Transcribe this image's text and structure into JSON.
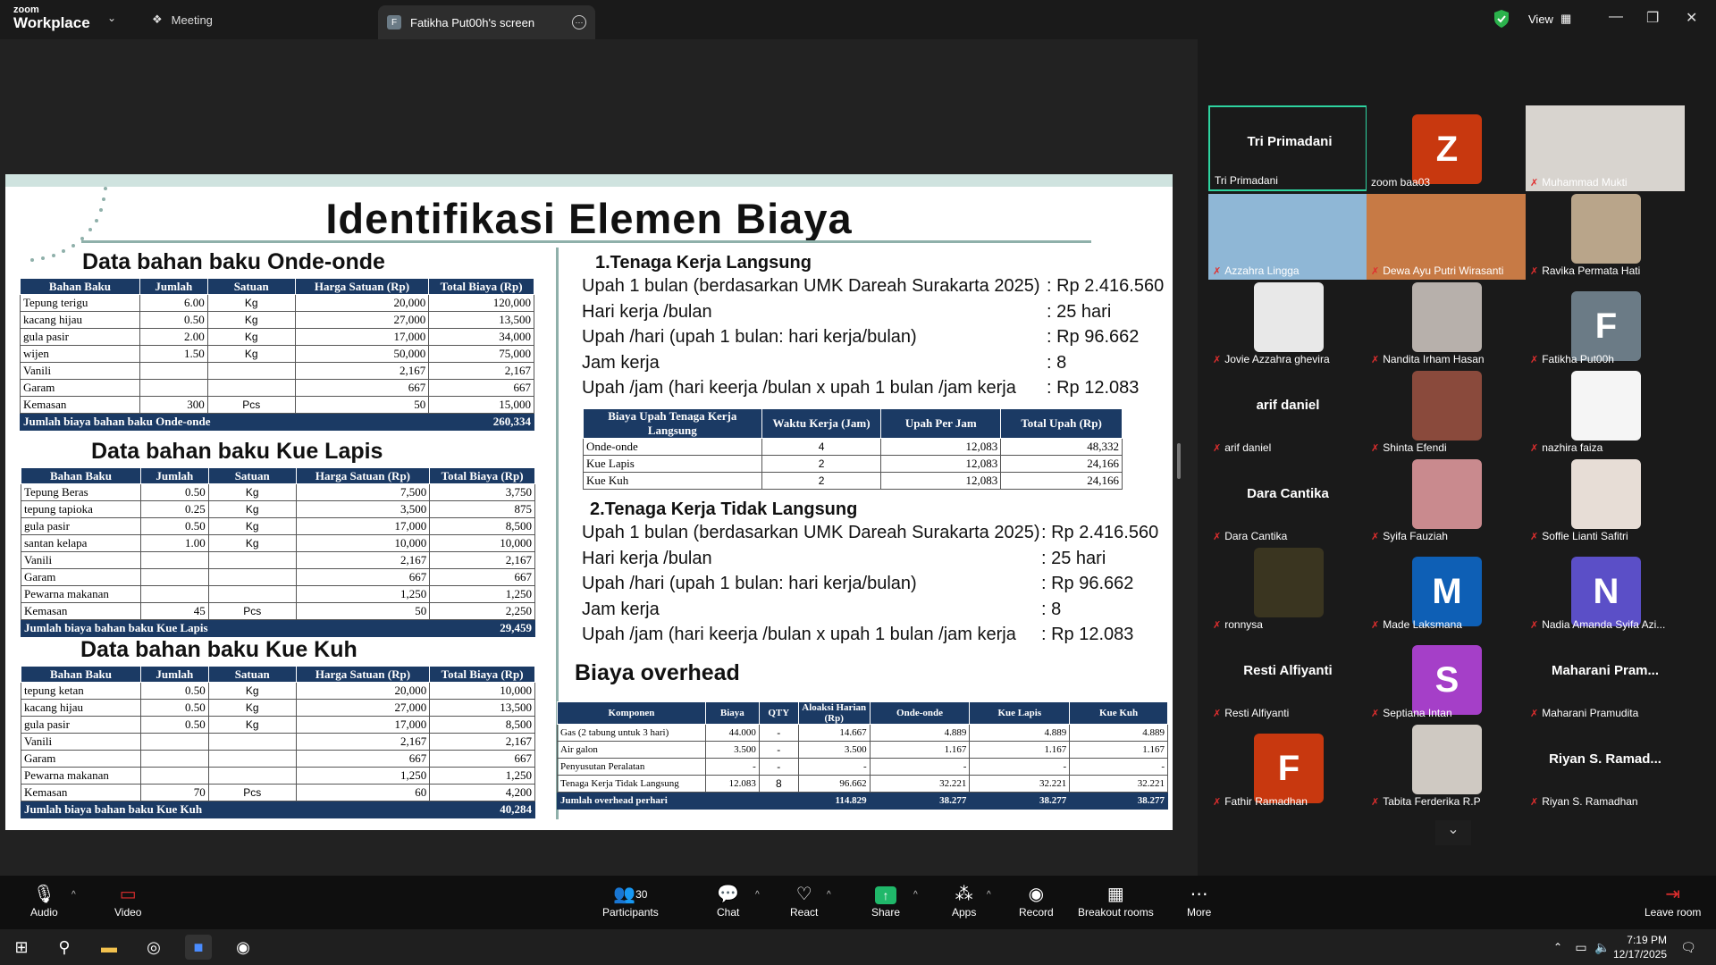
{
  "app": {
    "logo_line1": "zoom",
    "logo_line2": "Workplace",
    "meeting_tab": "Meeting",
    "share_tab": "Fatikha Put00h's screen",
    "share_badge": "F",
    "view_label": "View"
  },
  "colors": {
    "accent_green": "#2ed3a0",
    "table_header": "#1b3a64",
    "mic_muted": "#e02e2e"
  },
  "slide": {
    "title": "Identifikasi Elemen Biaya",
    "onde": {
      "heading": "Data bahan baku Onde-onde",
      "headers": [
        "Bahan Baku",
        "Jumlah",
        "Satuan",
        "Harga Satuan (Rp)",
        "Total Biaya (Rp)"
      ],
      "rows": [
        [
          "Tepung terigu",
          "6.00",
          "Kg",
          "20,000",
          "120,000"
        ],
        [
          "kacang hijau",
          "0.50",
          "Kg",
          "27,000",
          "13,500"
        ],
        [
          "gula pasir",
          "2.00",
          "Kg",
          "17,000",
          "34,000"
        ],
        [
          "wijen",
          "1.50",
          "Kg",
          "50,000",
          "75,000"
        ],
        [
          "Vanili",
          "",
          "",
          "2,167",
          "2,167"
        ],
        [
          "Garam",
          "",
          "",
          "667",
          "667"
        ],
        [
          "Kemasan",
          "300",
          "Pcs",
          "50",
          "15,000"
        ]
      ],
      "total_label": "Jumlah biaya bahan baku Onde-onde",
      "total": "260,334"
    },
    "lapis": {
      "heading": "Data bahan baku Kue Lapis",
      "headers": [
        "Bahan Baku",
        "Jumlah",
        "Satuan",
        "Harga Satuan (Rp)",
        "Total Biaya (Rp)"
      ],
      "rows": [
        [
          "Tepung Beras",
          "0.50",
          "Kg",
          "7,500",
          "3,750"
        ],
        [
          "tepung tapioka",
          "0.25",
          "Kg",
          "3,500",
          "875"
        ],
        [
          "gula pasir",
          "0.50",
          "Kg",
          "17,000",
          "8,500"
        ],
        [
          "santan kelapa",
          "1.00",
          "Kg",
          "10,000",
          "10,000"
        ],
        [
          "Vanili",
          "",
          "",
          "2,167",
          "2,167"
        ],
        [
          "Garam",
          "",
          "",
          "667",
          "667"
        ],
        [
          "Pewarna makanan",
          "",
          "",
          "1,250",
          "1,250"
        ],
        [
          "Kemasan",
          "45",
          "Pcs",
          "50",
          "2,250"
        ]
      ],
      "total_label": "Jumlah biaya bahan baku Kue Lapis",
      "total": "29,459"
    },
    "kuh": {
      "heading": "Data bahan baku Kue Kuh",
      "headers": [
        "Bahan Baku",
        "Jumlah",
        "Satuan",
        "Harga Satuan (Rp)",
        "Total Biaya (Rp)"
      ],
      "rows": [
        [
          "tepung ketan",
          "0.50",
          "Kg",
          "20,000",
          "10,000"
        ],
        [
          "kacang hijau",
          "0.50",
          "Kg",
          "27,000",
          "13,500"
        ],
        [
          "gula pasir",
          "0.50",
          "Kg",
          "17,000",
          "8,500"
        ],
        [
          "Vanili",
          "",
          "",
          "2,167",
          "2,167"
        ],
        [
          "Garam",
          "",
          "",
          "667",
          "667"
        ],
        [
          "Pewarna makanan",
          "",
          "",
          "1,250",
          "1,250"
        ],
        [
          "Kemasan",
          "70",
          "Pcs",
          "60",
          "4,200"
        ]
      ],
      "total_label": "Jumlah biaya bahan baku Kue Kuh",
      "total": "40,284"
    },
    "tkl": {
      "heading": "1.Tenaga Kerja Langsung",
      "lines": [
        [
          "Upah 1 bulan (berdasarkan UMK Dareah Surakarta 2025)",
          ": Rp 2.416.560"
        ],
        [
          "Hari kerja /bulan",
          ": 25 hari"
        ],
        [
          "Upah /hari (upah 1 bulan: hari kerja/bulan)",
          ": Rp 96.662"
        ],
        [
          "Jam kerja",
          ": 8"
        ],
        [
          "Upah /jam (hari keerja /bulan x upah 1 bulan /jam kerja",
          ": Rp 12.083"
        ]
      ],
      "headers": [
        "Biaya Upah Tenaga Kerja Langsung",
        "Waktu Kerja (Jam)",
        "Upah Per Jam",
        "Total Upah (Rp)"
      ],
      "rows": [
        [
          "Onde-onde",
          "4",
          "12,083",
          "48,332"
        ],
        [
          "Kue Lapis",
          "2",
          "12,083",
          "24,166"
        ],
        [
          "Kue Kuh",
          "2",
          "12,083",
          "24,166"
        ]
      ]
    },
    "tktl": {
      "heading": "2.Tenaga Kerja Tidak Langsung",
      "lines": [
        [
          "Upah 1 bulan (berdasarkan UMK Dareah Surakarta 2025)",
          ": Rp 2.416.560"
        ],
        [
          "Hari kerja /bulan",
          ": 25 hari"
        ],
        [
          "Upah /hari (upah 1 bulan: hari kerja/bulan)",
          ": Rp 96.662"
        ],
        [
          "Jam kerja",
          ": 8"
        ],
        [
          "Upah /jam (hari keerja /bulan x upah 1 bulan /jam kerja",
          ": Rp 12.083"
        ]
      ]
    },
    "overhead": {
      "heading": "Biaya overhead",
      "headers": [
        "Komponen",
        "Biaya",
        "QTY",
        "Aloaksi Harian (Rp)",
        "Onde-onde",
        "Kue Lapis",
        "Kue Kuh"
      ],
      "rows": [
        [
          "Gas (2 tabung untuk 3 hari)",
          "44.000",
          "-",
          "14.667",
          "4.889",
          "4.889",
          "4.889"
        ],
        [
          "Air galon",
          "3.500",
          "-",
          "3.500",
          "1.167",
          "1.167",
          "1.167"
        ],
        [
          "Penyusutan Peralatan",
          "-",
          "-",
          "-",
          "-",
          "-",
          "-"
        ],
        [
          "Tenaga Kerja Tidak Langsung",
          "12.083",
          "8",
          "96.662",
          "32.221",
          "32.221",
          "32.221"
        ]
      ],
      "total": [
        "Jumlah overhead perhari",
        "",
        "",
        "114.829",
        "38.277",
        "38.277",
        "38.277"
      ]
    }
  },
  "gallery": [
    {
      "name": "Tri Primadani",
      "big": "Tri Primadani",
      "kind": "name",
      "active": true,
      "muted": false
    },
    {
      "name": "zoom baa03",
      "kind": "avatar",
      "letter": "Z",
      "color": "#c8380f",
      "muted": false
    },
    {
      "name": "Muhammad Mukti",
      "kind": "photo",
      "color": "#d8d4cf",
      "muted": true
    },
    {
      "name": "Azzahra Lingga",
      "kind": "photo",
      "color": "#8fb7d6",
      "muted": true
    },
    {
      "name": "Dewa Ayu Putri Wirasanti",
      "kind": "photo",
      "color": "#c77a45",
      "muted": true
    },
    {
      "name": "Ravika Permata Hati",
      "kind": "photo",
      "color": "#b9a58a",
      "muted": true
    },
    {
      "name": "Jovie Azzahra ghevira",
      "kind": "photo",
      "color": "#e8e8e8",
      "muted": true
    },
    {
      "name": "Nandita Irham Hasan",
      "kind": "photo",
      "color": "#b7b0ab",
      "muted": true
    },
    {
      "name": "Fatikha Put00h",
      "kind": "avatar",
      "letter": "F",
      "color": "#6b7b86",
      "muted": true
    },
    {
      "name": "arif daniel",
      "big": "arif daniel",
      "kind": "name",
      "muted": true
    },
    {
      "name": "Shinta Efendi",
      "kind": "photo",
      "color": "#8a4a3c",
      "muted": true
    },
    {
      "name": "nazhira faiza",
      "kind": "photo",
      "color": "#f5f5f5",
      "muted": true
    },
    {
      "name": "Dara Cantika",
      "big": "Dara Cantika",
      "kind": "name",
      "muted": true
    },
    {
      "name": "Syifa Fauziah",
      "kind": "photo",
      "color": "#c98a8e",
      "muted": true
    },
    {
      "name": "Soffie Lianti Safitri",
      "kind": "photo",
      "color": "#e7ddd6",
      "muted": true
    },
    {
      "name": "ronnysa",
      "kind": "photo",
      "color": "#3a3520",
      "muted": true
    },
    {
      "name": "Made Laksmana",
      "kind": "avatar",
      "letter": "M",
      "color": "#0e5fb5",
      "muted": true
    },
    {
      "name": "Nadia Amanda Syifa Azi...",
      "kind": "avatar",
      "letter": "N",
      "color": "#5b4fc7",
      "muted": true
    },
    {
      "name": "Resti Alfiyanti",
      "big": "Resti Alfiyanti",
      "kind": "name",
      "muted": true
    },
    {
      "name": "Septiana Intan",
      "kind": "avatar",
      "letter": "S",
      "color": "#a53fc8",
      "muted": true
    },
    {
      "name": "Maharani Pramudita",
      "big": "Maharani  Pram...",
      "kind": "name",
      "muted": true
    },
    {
      "name": "Fathir Ramadhan",
      "kind": "avatar",
      "letter": "F",
      "color": "#c8380f",
      "muted": true
    },
    {
      "name": "Tabita Ferderika R.P",
      "kind": "photo",
      "color": "#cfc9c2",
      "muted": true
    },
    {
      "name": "Riyan S. Ramadhan",
      "big": "Riyan  S.  Ramad...",
      "kind": "name",
      "muted": true
    }
  ],
  "toolbar": {
    "audio": "Audio",
    "video": "Video",
    "participants": "Participants",
    "participants_count": "30",
    "chat": "Chat",
    "react": "React",
    "share": "Share",
    "apps": "Apps",
    "record": "Record",
    "breakout": "Breakout rooms",
    "more": "More",
    "leave": "Leave room"
  },
  "taskbar": {
    "time": "7:19 PM",
    "date": "12/17/2025"
  }
}
